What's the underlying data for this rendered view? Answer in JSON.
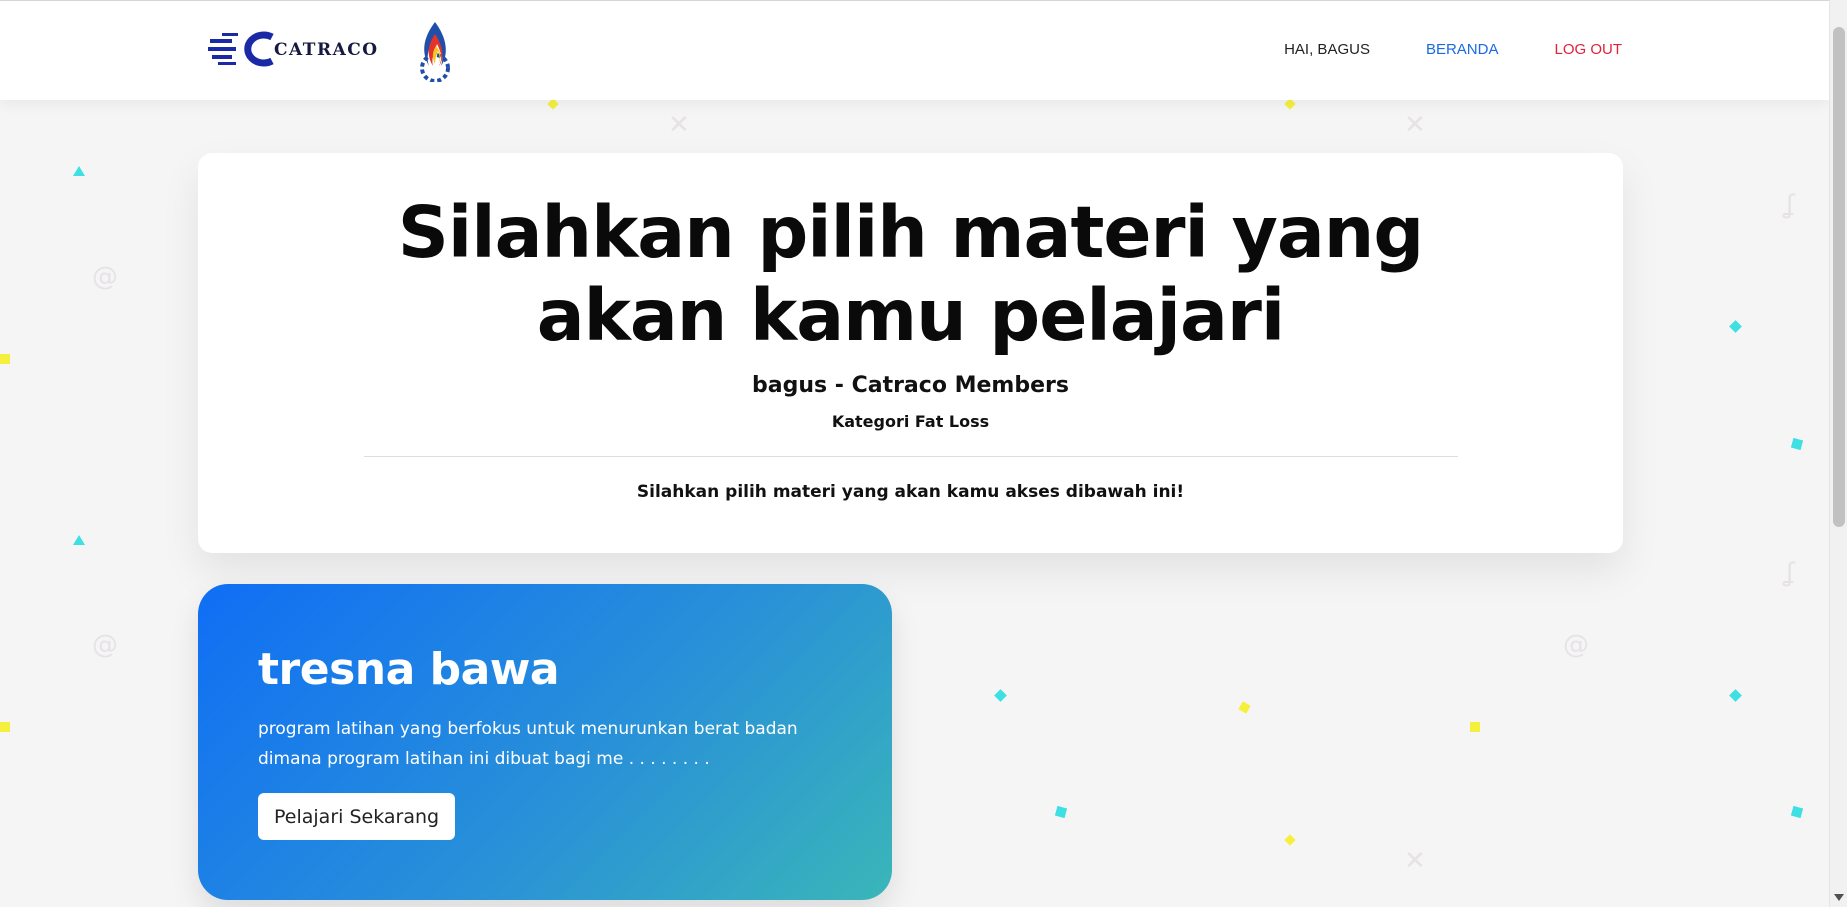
{
  "navbar": {
    "brand_text": "CATRACO",
    "greeting": "HAI, BAGUS",
    "home": "BERANDA",
    "logout": "LOG OUT"
  },
  "hero": {
    "title": "Silahkan pilih materi yang akan kamu pelajari",
    "subtitle": "bagus - Catraco Members",
    "category": "Kategori Fat Loss",
    "note": "Silahkan pilih materi yang akan kamu akses dibawah ini!"
  },
  "materials": [
    {
      "title": "tresna bawa",
      "description": "program latihan yang berfokus untuk menurunkan berat badan dimana program latihan ini dibuat bagi me . . . . . . . .",
      "button": "Pelajari Sekarang"
    }
  ],
  "colors": {
    "accent_blue": "#1b6ae0",
    "logout_red": "#e0233a",
    "card_gradient_start": "#0f6ef5",
    "card_gradient_end": "#3ab6b8"
  }
}
